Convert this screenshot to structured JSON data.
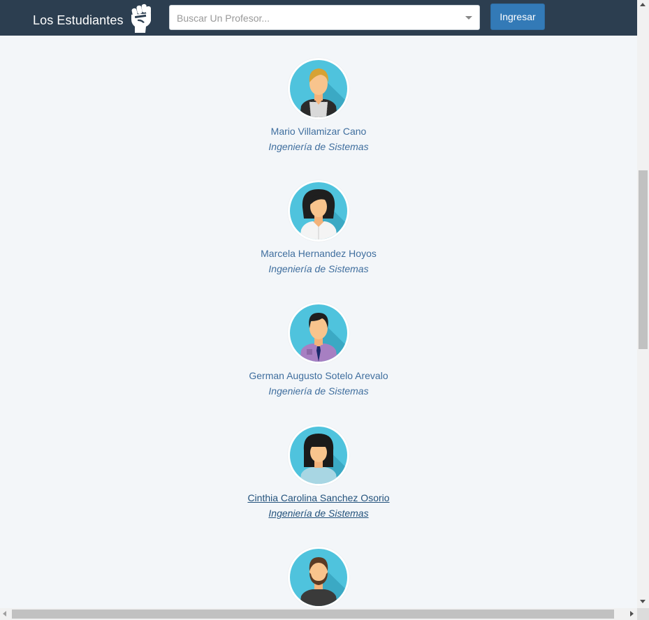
{
  "navbar": {
    "brand": "Los Estudiantes",
    "logo_icon": "raised-fist-icon",
    "search_placeholder": "Buscar Un Profesor...",
    "login_label": "Ingresar"
  },
  "colors": {
    "navbar_bg": "#2c3e50",
    "page_bg": "#f3f6f9",
    "link": "#3f6e9e",
    "button": "#337ab7",
    "avatar_bg": "#4fc3dd"
  },
  "professors": [
    {
      "name": "Mario Villamizar Cano",
      "department": "Ingeniería de Sistemas",
      "avatar_icon": "male-blond-avatar-icon"
    },
    {
      "name": "Marcela Hernandez Hoyos",
      "department": "Ingeniería de Sistemas",
      "avatar_icon": "female-dark-hair-avatar-icon"
    },
    {
      "name": "German Augusto Sotelo Arevalo",
      "department": "Ingeniería de Sistemas",
      "avatar_icon": "male-tie-avatar-icon"
    },
    {
      "name": "Cinthia Carolina Sanchez Osorio",
      "department": "Ingeniería de Sistemas",
      "avatar_icon": "female-bangs-avatar-icon"
    },
    {
      "name": "",
      "department": "",
      "avatar_icon": "male-beard-avatar-icon"
    }
  ]
}
